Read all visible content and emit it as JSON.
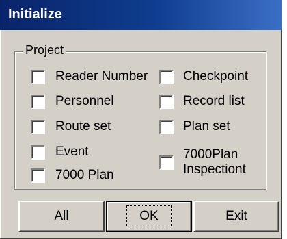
{
  "window": {
    "title": "Initialize"
  },
  "group": {
    "label": "Project"
  },
  "checkboxes": [
    {
      "label": "Reader Number",
      "checked": false
    },
    {
      "label": "Checkpoint",
      "checked": false
    },
    {
      "label": "Personnel",
      "checked": false
    },
    {
      "label": "Record list",
      "checked": false
    },
    {
      "label": "Route set",
      "checked": false
    },
    {
      "label": "Plan set",
      "checked": false
    },
    {
      "label": "Event",
      "checked": false
    },
    {
      "label_line1": "7000Plan",
      "label_line2": "Inspectiont",
      "checked": false
    },
    {
      "label": "7000 Plan",
      "checked": false
    }
  ],
  "buttons": {
    "all": "All",
    "ok": "OK",
    "exit": "Exit"
  }
}
